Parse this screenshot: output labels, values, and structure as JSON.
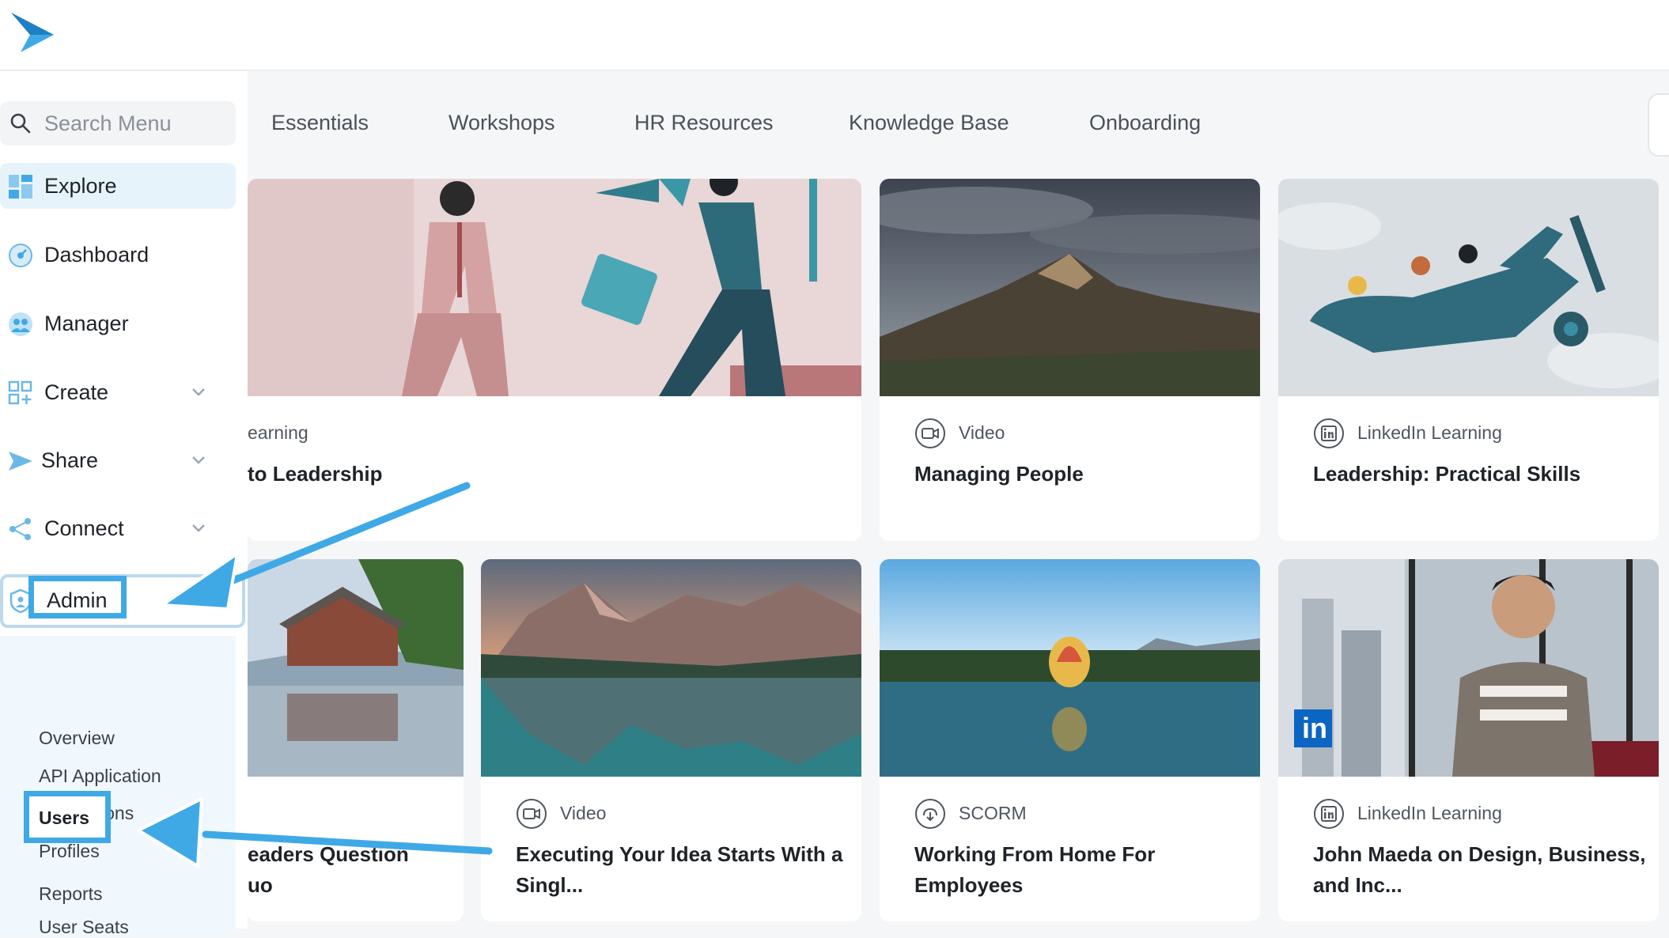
{
  "sidebar": {
    "search_placeholder": "Search Menu",
    "items": [
      {
        "label": "Explore"
      },
      {
        "label": "Dashboard"
      },
      {
        "label": "Manager"
      },
      {
        "label": "Create"
      },
      {
        "label": "Share"
      },
      {
        "label": "Connect"
      },
      {
        "label": "Admin"
      }
    ],
    "admin_subitems": [
      {
        "label": "Overview"
      },
      {
        "label": "API Application"
      },
      {
        "label": "Integrations"
      },
      {
        "label": "Profiles"
      },
      {
        "label": "Users"
      },
      {
        "label": "User Seats"
      },
      {
        "label": "Reports"
      }
    ]
  },
  "tabs": [
    {
      "label": "Essentials"
    },
    {
      "label": "Workshops"
    },
    {
      "label": "HR Resources"
    },
    {
      "label": "Knowledge Base"
    },
    {
      "label": "Onboarding"
    }
  ],
  "cards": [
    {
      "type": "earning",
      "title": "to Leadership"
    },
    {
      "type": "Video",
      "title": "Managing People"
    },
    {
      "type": "LinkedIn Learning",
      "title": "Leadership: Practical Skills"
    },
    {
      "type": "",
      "title": "eaders Question\nuo"
    },
    {
      "type": "Video",
      "title": "Executing Your Idea Starts With a Singl..."
    },
    {
      "type": "SCORM",
      "title": "Working From Home For Employees"
    },
    {
      "type": "LinkedIn Learning",
      "title": "John Maeda on Design, Business, and Inc..."
    }
  ],
  "colors": {
    "accent": "#3fa9e6",
    "active_bg": "#e7f3fb",
    "subnav_bg": "#f0f8fd"
  }
}
